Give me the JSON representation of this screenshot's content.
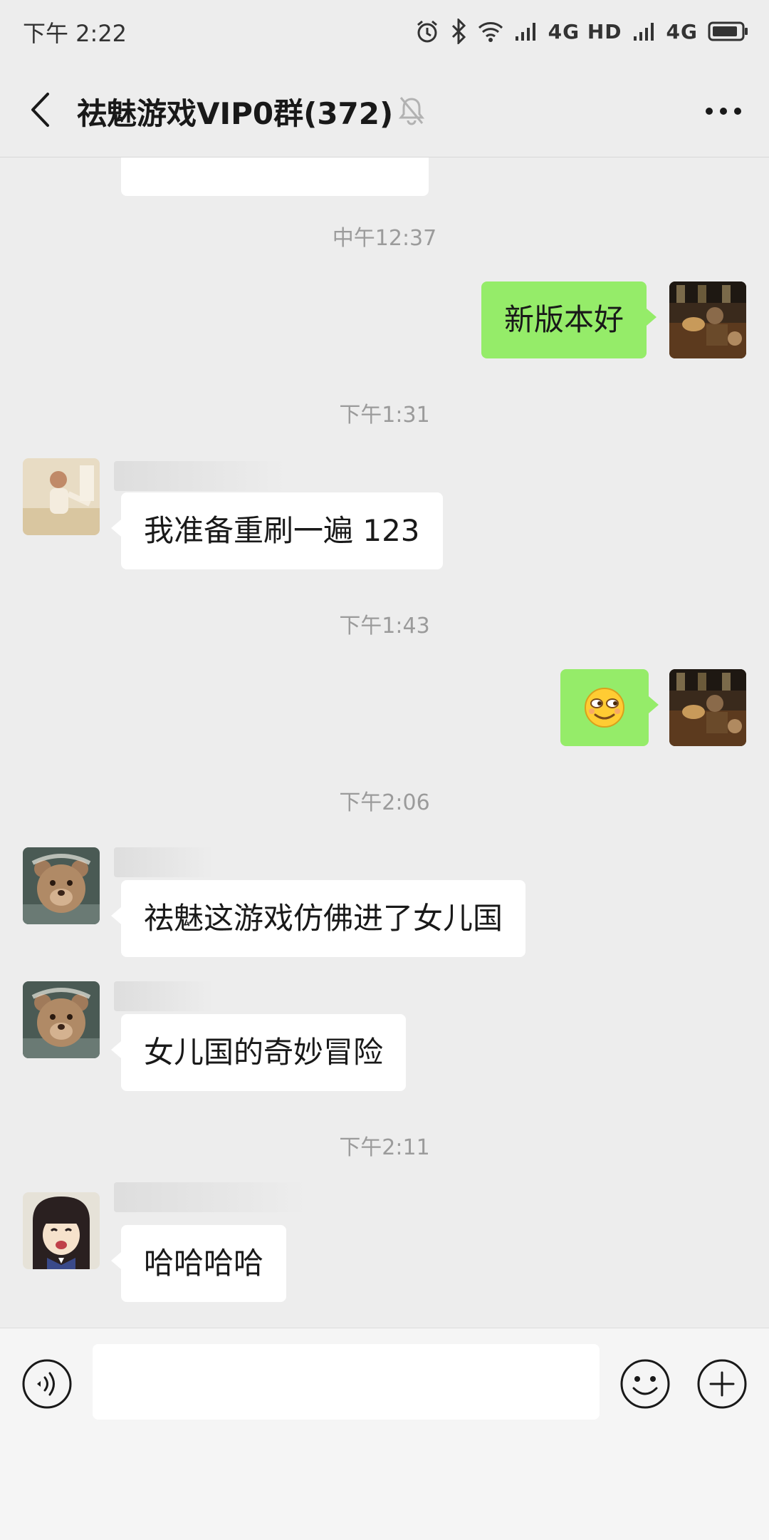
{
  "status_bar": {
    "time": "下午 2:22",
    "network": "4G HD",
    "network2": "4G"
  },
  "nav": {
    "title": "祛魅游戏VIP0群(372)"
  },
  "messages": {
    "ts1": "中午12:37",
    "sent1": "新版本好",
    "ts2": "下午1:31",
    "recv1": "我准备重刷一遍 123",
    "ts3": "下午1:43",
    "ts4": "下午2:06",
    "recv2": "祛魅这游戏仿佛进了女儿国",
    "recv3": "女儿国的奇妙冒险",
    "ts5": "下午2:11",
    "recv4": "哈哈哈哈"
  },
  "input": {
    "value": "",
    "placeholder": ""
  },
  "colors": {
    "background": "#ededed",
    "sent_bubble": "#95ec69",
    "recv_bubble": "#ffffff",
    "timestamp": "#9b9b9b"
  },
  "icons": [
    "alarm-icon",
    "bluetooth-icon",
    "wifi-icon",
    "signal-icon",
    "battery-icon",
    "back-arrow-icon",
    "mute-bell-icon",
    "more-dots-icon",
    "voice-icon",
    "emoji-icon",
    "plus-icon",
    "smirk-emoji-icon"
  ]
}
